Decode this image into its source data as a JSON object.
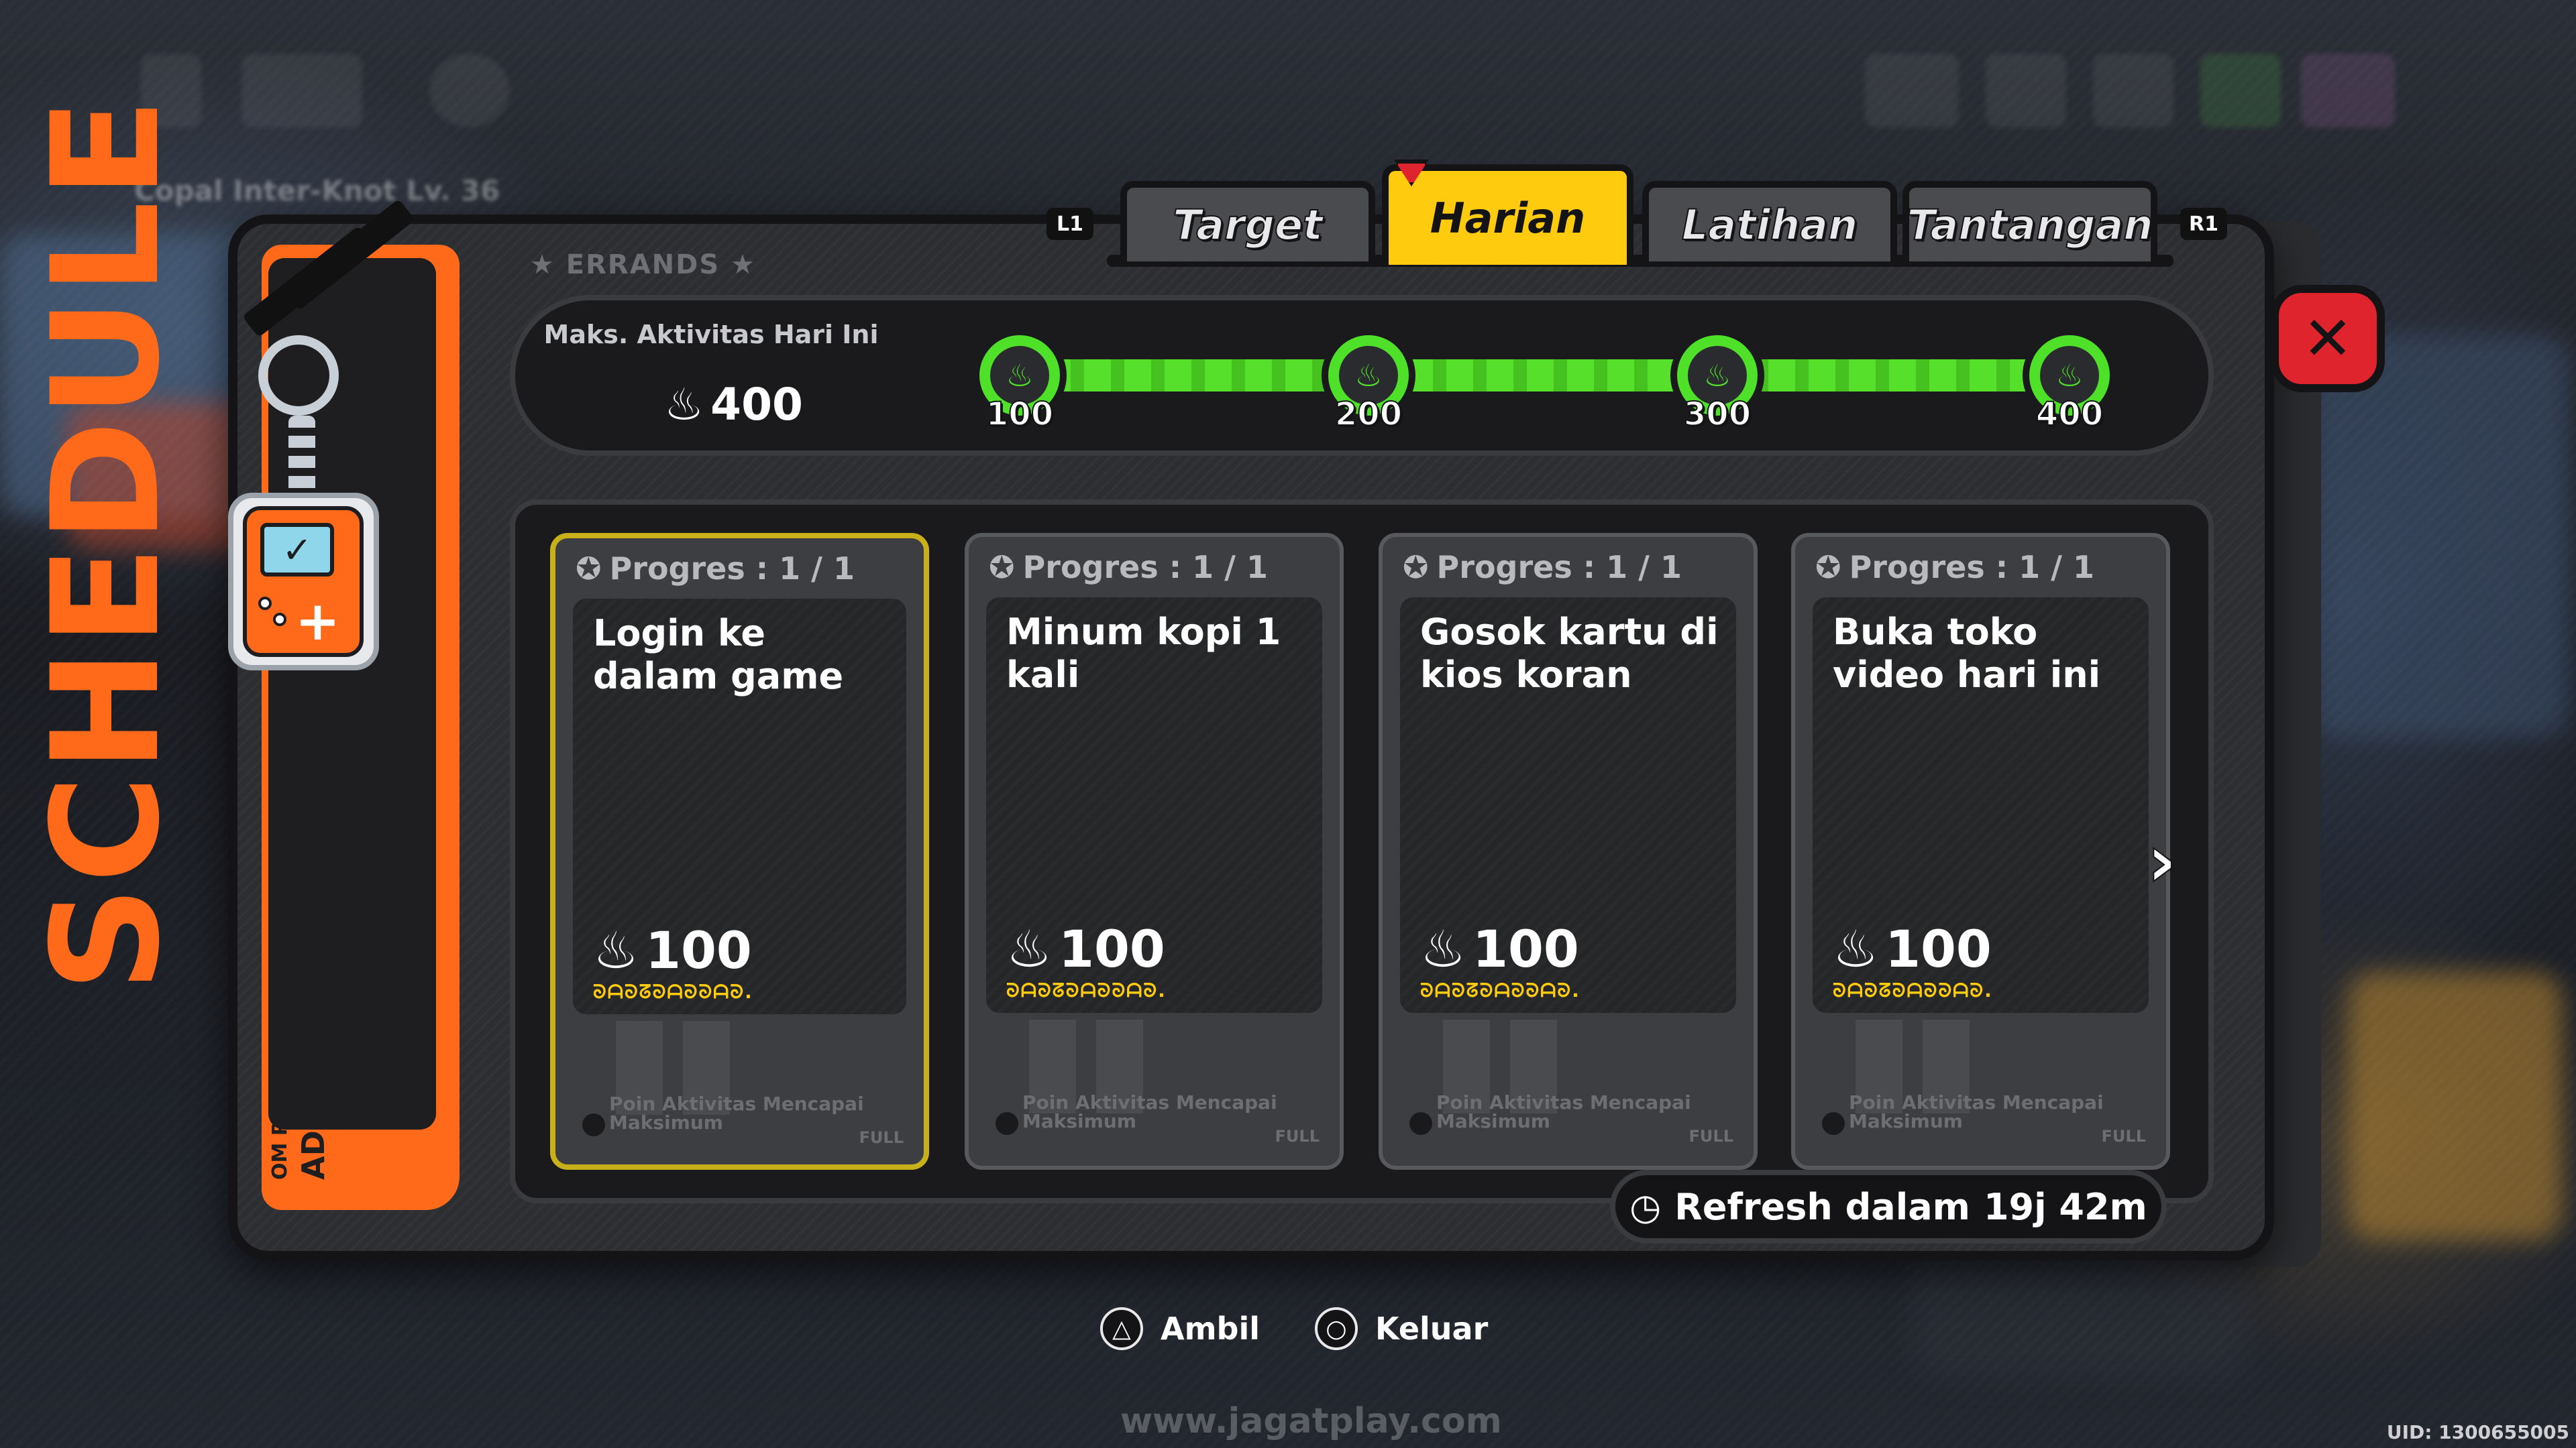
{
  "colors": {
    "accent_yellow": "#ffcb0e",
    "schedule_orange": "#ff6a1a",
    "progress_green": "#4fe02a",
    "close_red": "#e0242e",
    "panel_dark": "#2d2e31"
  },
  "hud": {
    "location_text": "Copal Inter-Knot Lv. 36"
  },
  "schedule": {
    "side_word": "SCHEDULE",
    "small_line_1": "OM PLAY",
    "small_line_2": "ADS"
  },
  "header": {
    "section_label": "ERRANDS",
    "l1": "L1",
    "r1": "R1"
  },
  "tabs": [
    {
      "label": "Target",
      "active": false
    },
    {
      "label": "Harian",
      "active": true
    },
    {
      "label": "Latihan",
      "active": false
    },
    {
      "label": "Tantangan",
      "active": false
    }
  ],
  "activity": {
    "max_label": "Maks. Aktivitas Hari Ini",
    "max_value": "400",
    "milestones": [
      "100",
      "200",
      "300",
      "400"
    ],
    "progress_fraction": 1.0
  },
  "cards": [
    {
      "progress": "Progres : 1 / 1",
      "title": "Login ke dalam game",
      "points": "100",
      "glyph": "ᘐᗩᘐᘔᘐᗩᘐᘐᗩᘐ.",
      "footer": "Poin Aktivitas Mencapai Maksimum",
      "full": "FULL",
      "selected": true
    },
    {
      "progress": "Progres : 1 / 1",
      "title": "Minum kopi 1 kali",
      "points": "100",
      "glyph": "ᘐᗩᘐᘔᘐᗩᘐᘐᗩᘐ.",
      "footer": "Poin Aktivitas Mencapai Maksimum",
      "full": "FULL",
      "selected": false
    },
    {
      "progress": "Progres : 1 / 1",
      "title": "Gosok kartu di kios koran",
      "points": "100",
      "glyph": "ᘐᗩᘐᘔᘐᗩᘐᘐᗩᘐ.",
      "footer": "Poin Aktivitas Mencapai Maksimum",
      "full": "FULL",
      "selected": false
    },
    {
      "progress": "Progres : 1 / 1",
      "title": "Buka toko video hari ini",
      "points": "100",
      "glyph": "ᘐᗩᘐᘔᘐᗩᘐᘐᗩᘐ.",
      "footer": "Poin Aktivitas Mencapai Maksimum",
      "full": "FULL",
      "selected": false
    }
  ],
  "refresh": {
    "label": "Refresh dalam",
    "time": "19j 42m"
  },
  "prompts": {
    "claim_label": "Ambil",
    "exit_label": "Keluar"
  },
  "watermark": "www.jagatplay.com",
  "uid": "UID: 1300655005",
  "icons": {
    "close": "close-x-icon",
    "next": "chevron-right-icon",
    "clock": "clock-icon",
    "flame": "flame-icon",
    "star": "star-icon",
    "triangle": "triangle-button-icon",
    "circle": "circle-button-icon"
  }
}
